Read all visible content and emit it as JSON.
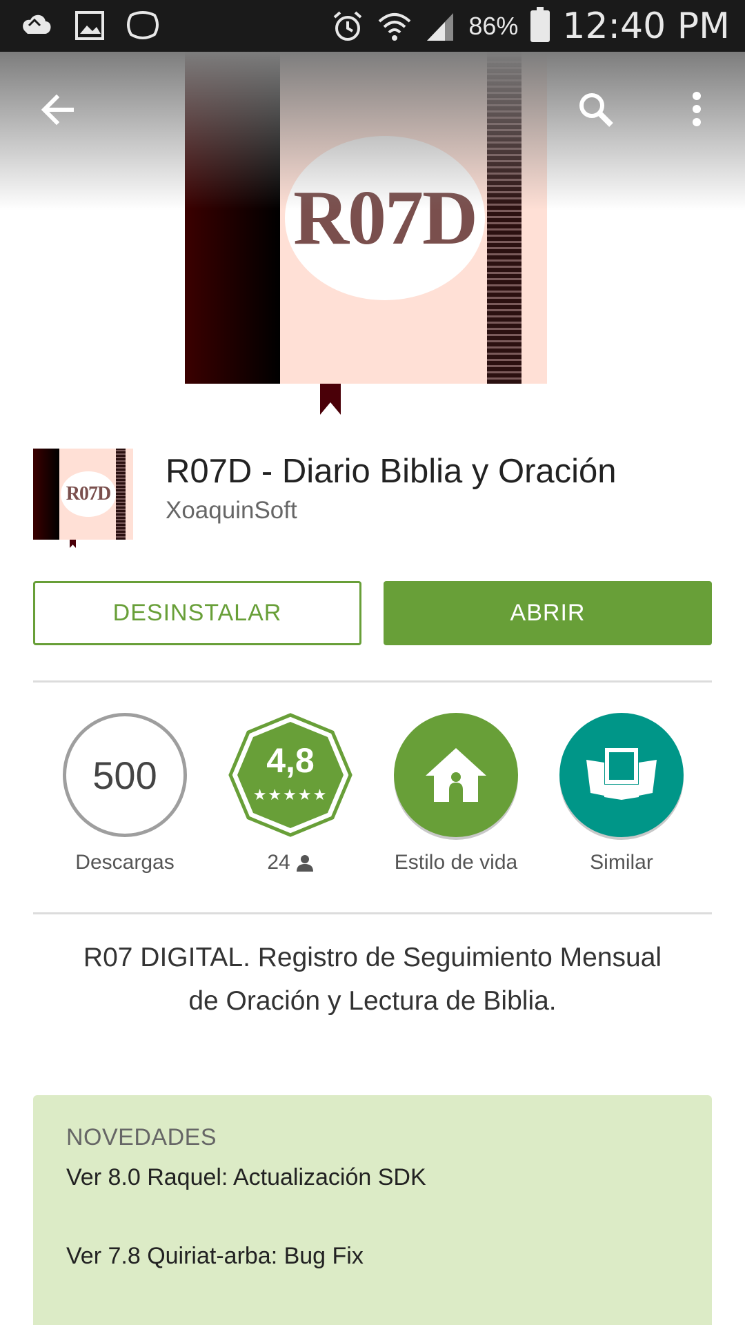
{
  "status_bar": {
    "battery": "86%",
    "time": "12:40 PM",
    "icons": [
      "notification-icon",
      "gallery-icon",
      "chat-icon",
      "alarm-icon",
      "wifi-icon",
      "signal-icon",
      "battery-icon"
    ]
  },
  "header": {
    "banner_text": "R07D",
    "actions": [
      "back-arrow-icon",
      "search-icon",
      "more-vert-icon"
    ]
  },
  "app": {
    "icon_text": "R07D",
    "title": "R07D - Diario Biblia y Oración",
    "developer": "XoaquinSoft"
  },
  "buttons": {
    "uninstall": "DESINSTALAR",
    "open": "ABRIR"
  },
  "stats": {
    "downloads_value": "500",
    "downloads_label": "Descargas",
    "rating_value": "4,8",
    "rating_stars": "★★★★★",
    "rating_count": "24",
    "category_label": "Estilo de vida",
    "similar_label": "Similar"
  },
  "description": {
    "line1": "R07 DIGITAL.  Registro de Seguimiento Mensual",
    "line2": "de Oración y Lectura de Biblia."
  },
  "whats_new": {
    "title": "NOVEDADES",
    "items": [
      "Ver 8.0 Raquel: Actualización SDK",
      "Ver 7.8 Quiriat-arba: Bug Fix"
    ]
  },
  "colors": {
    "accent_green": "#689f38",
    "teal": "#009688",
    "news_bg": "#dcebc6"
  }
}
